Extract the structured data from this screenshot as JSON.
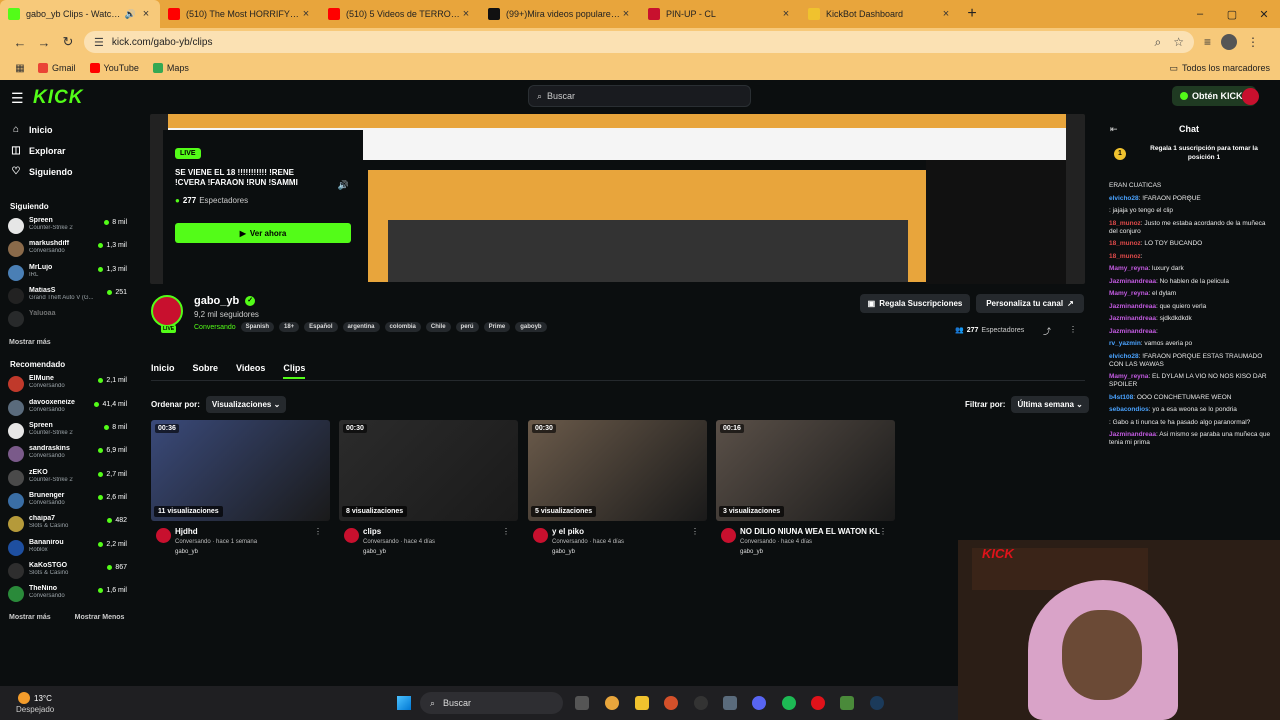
{
  "browser": {
    "tabs": [
      {
        "title": "gabo_yb Clips - Watch Live",
        "active": true,
        "color": "#53fc18",
        "extra": "🔊"
      },
      {
        "title": "(510) The Most HORRIFYING V",
        "active": false,
        "color": "#ff0000"
      },
      {
        "title": "(510) 5 Videos de TERROR EXT",
        "active": false,
        "color": "#ff0000"
      },
      {
        "title": "(99+)Mira videos populares se",
        "active": false,
        "color": "#111111"
      },
      {
        "title": "PIN-UP - CL",
        "active": false,
        "color": "#c8102e"
      },
      {
        "title": "KickBot Dashboard",
        "active": false,
        "color": "#f0c22e"
      }
    ],
    "url": "kick.com/gabo-yb/clips",
    "bookmarks": [
      {
        "label": "Gmail",
        "color": "#ea4335"
      },
      {
        "label": "YouTube",
        "color": "#ff0000"
      },
      {
        "label": "Maps",
        "color": "#34a853"
      }
    ],
    "all_bookmarks": "Todos los marcadores"
  },
  "header": {
    "logo": "KICK",
    "search_placeholder": "Buscar",
    "kicks_label": "Obtén KICKs"
  },
  "sidebar": {
    "nav": [
      {
        "label": "Inicio",
        "icon": "⌂"
      },
      {
        "label": "Explorar",
        "icon": "◫"
      },
      {
        "label": "Siguiendo",
        "icon": "♡"
      }
    ],
    "following_title": "Siguiendo",
    "following": [
      {
        "name": "Spreen",
        "category": "Counter-Strike 2",
        "viewers": "8 mil",
        "color": "#e6e6e6"
      },
      {
        "name": "markushdiff",
        "category": "Conversando",
        "viewers": "1,3 mil",
        "color": "#8a6a4a"
      },
      {
        "name": "MrLujo",
        "category": "IRL",
        "viewers": "1,3 mil",
        "color": "#4a7fb5"
      },
      {
        "name": "MatiasS",
        "category": "Grand Theft Auto V (G...",
        "viewers": "251",
        "color": "#222222"
      },
      {
        "name": "Yaluoaa",
        "category": "",
        "viewers": "",
        "color": "#555555"
      }
    ],
    "show_more": "Mostrar más",
    "recommended_title": "Recomendado",
    "recommended": [
      {
        "name": "ElMune",
        "category": "Conversando",
        "viewers": "2,1 mil",
        "color": "#c0392b"
      },
      {
        "name": "davooxeneize",
        "category": "Conversando",
        "viewers": "41,4 mil",
        "color": "#5a6b7c"
      },
      {
        "name": "Spreen",
        "category": "Counter-Strike 2",
        "viewers": "8 mil",
        "color": "#e6e6e6"
      },
      {
        "name": "sandraskins",
        "category": "Conversando",
        "viewers": "6,9 mil",
        "color": "#7a5a8a"
      },
      {
        "name": "zEKO",
        "category": "Counter-Strike 2",
        "viewers": "2,7 mil",
        "color": "#4a4a4a"
      },
      {
        "name": "Brunenger",
        "category": "Conversando",
        "viewers": "2,6 mil",
        "color": "#3a6ea5"
      },
      {
        "name": "chaipa7",
        "category": "Slots & Casino",
        "viewers": "482",
        "color": "#b59a3a"
      },
      {
        "name": "Bananirou",
        "category": "Roblox",
        "viewers": "2,2 mil",
        "color": "#1e4fa0"
      },
      {
        "name": "KaKoSTGO",
        "category": "Slots & Casino",
        "viewers": "867",
        "color": "#2e2e2e"
      },
      {
        "name": "TheNino",
        "category": "Conversando",
        "viewers": "1,6 mil",
        "color": "#2a8a3a"
      }
    ],
    "show_more2": "Mostrar más",
    "show_less": "Mostrar Menos"
  },
  "live": {
    "badge": "LIVE",
    "title": "SE VIENE EL 18 !!!!!!!!!!! !RENE !CVERA !FARAON !RUN !SAMMI",
    "viewers": "277",
    "viewers_label": "Espectadores",
    "watch_button": "Ver ahora"
  },
  "profile": {
    "name": "gabo_yb",
    "live_badge": "LIVE",
    "followers": "9,2 mil seguidores",
    "category": "Conversando",
    "tags": [
      "Spanish",
      "18+",
      "Español",
      "argentina",
      "colombia",
      "Chile",
      "perú",
      "Prime",
      "gaboyb"
    ],
    "gift_button": "Regala Suscripciones",
    "custom_button": "Personaliza tu canal",
    "viewers": "277",
    "viewers_label": "Espectadores"
  },
  "profile_tabs": [
    "Inicio",
    "Sobre",
    "Videos",
    "Clips"
  ],
  "active_tab": "Clips",
  "sort": {
    "label": "Ordenar por:",
    "value": "Visualizaciones",
    "filter_label": "Filtrar por:",
    "filter_value": "Última semana"
  },
  "clips": [
    {
      "duration": "00:36",
      "views": "11 visualizaciones",
      "title": "Hjdhd",
      "meta": "Conversando · hace 1 semana",
      "channel": "gabo_yb",
      "color": "#3a4a7a"
    },
    {
      "duration": "00:30",
      "views": "8 visualizaciones",
      "title": "clips",
      "meta": "Conversando · hace 4 días",
      "channel": "gabo_yb",
      "color": "#2b2b2b"
    },
    {
      "duration": "00:30",
      "views": "5 visualizaciones",
      "title": "y el piko",
      "meta": "Conversando · hace 4 días",
      "channel": "gabo_yb",
      "color": "#6a5a4a"
    },
    {
      "duration": "00:16",
      "views": "3 visualizaciones",
      "title": "NO DILIO NIUNA WEA EL WATON KL",
      "meta": "Conversando · hace 4 días",
      "channel": "gabo_yb",
      "color": "#5a5048"
    }
  ],
  "chat": {
    "title": "Chat",
    "pinned": "Regala 1 suscripción para tomar la posición 1",
    "messages": [
      {
        "user": "",
        "text": "ERAN CUATICAS",
        "color": "#ffffff"
      },
      {
        "user": "elvicho28",
        "text": ": !FARAON PORQUE",
        "color": "#4aa3ff"
      },
      {
        "user": "",
        "text": ": jajaja yo tengo el clip",
        "color": "#c25ae0"
      },
      {
        "user": "18_munoz",
        "text": ": Justo me estaba acordando de la muñeca del conjuro",
        "color": "#e04a4a"
      },
      {
        "user": "18_munoz",
        "text": ": LO TOY BUCANDO",
        "color": "#e04a4a"
      },
      {
        "user": "18_munoz",
        "text": ":",
        "color": "#e04a4a"
      },
      {
        "user": "Mamy_reyna",
        "text": ": luxury dark",
        "color": "#c25ae0"
      },
      {
        "user": "Jazminandreaa",
        "text": ": No hablen de la pelicula",
        "color": "#c25ae0"
      },
      {
        "user": "Mamy_reyna",
        "text": ": el dylam",
        "color": "#c25ae0"
      },
      {
        "user": "Jazminandreaa",
        "text": ": que quiero verla",
        "color": "#c25ae0"
      },
      {
        "user": "Jazminandreaa",
        "text": ": sjdkdkdkdk",
        "color": "#c25ae0"
      },
      {
        "user": "Jazminandreaa",
        "text": ":",
        "color": "#c25ae0"
      },
      {
        "user": "rv_yazmin",
        "text": ": vamos averia po",
        "color": "#4aa3ff"
      },
      {
        "user": "elvicho28",
        "text": ": !FARAON PORQUE ESTAS TRAUMADO CON LAS WAWAS",
        "color": "#4aa3ff"
      },
      {
        "user": "Mamy_reyna",
        "text": ": EL DYLAM LA VIO NO NOS KISO DAR SPOILER",
        "color": "#c25ae0"
      },
      {
        "user": "b4st108",
        "text": ": OOO CONCHETUMARE WEON",
        "color": "#4aa3ff"
      },
      {
        "user": "sebacondios",
        "text": ": yo a esa weona se lo pondria",
        "color": "#4aa3ff"
      },
      {
        "user": "",
        "text": ": Gabo a ti nunca te ha pasado algo paranormal?",
        "color": "#c25ae0"
      },
      {
        "user": "Jazminandreaa",
        "text": ": Asi mismo se paraba una muñeca que tenia mi prima",
        "color": "#c25ae0"
      }
    ]
  },
  "taskbar": {
    "temp": "13°C",
    "weather": "Despejado",
    "search": "Buscar"
  }
}
